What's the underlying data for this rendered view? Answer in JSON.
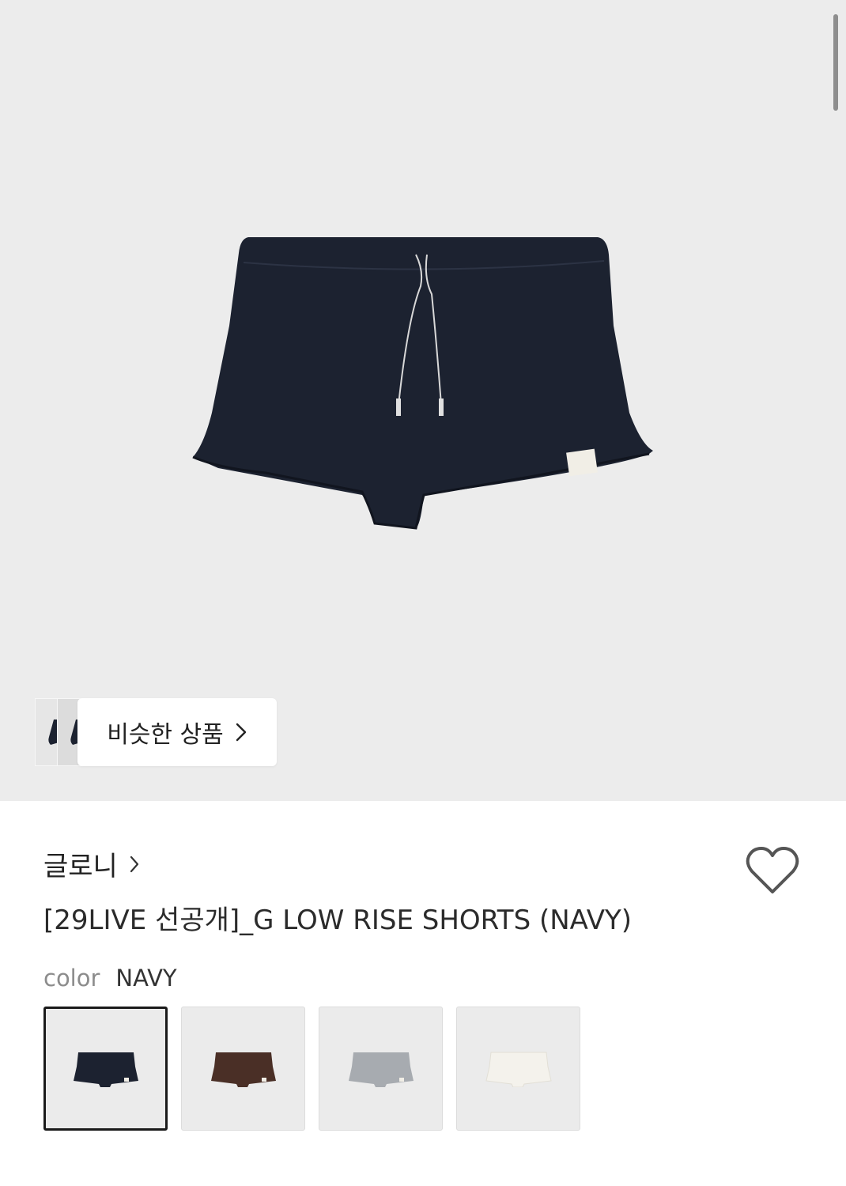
{
  "similar": {
    "label": "비슷한 상품"
  },
  "brand": {
    "name": "글로니"
  },
  "product": {
    "title": "[29LIVE 선공개]_G LOW RISE SHORTS (NAVY)"
  },
  "options": {
    "color_label": "color",
    "color_value": "NAVY",
    "swatches": [
      {
        "name": "NAVY",
        "color": "#1c2230",
        "selected": true
      },
      {
        "name": "BROWN",
        "color": "#4a2f26",
        "selected": false
      },
      {
        "name": "GRAY",
        "color": "#a7abb0",
        "selected": false
      },
      {
        "name": "WHITE",
        "color": "#f4f2ec",
        "selected": false
      }
    ]
  },
  "icons": {
    "chevron": "chevron-right-icon",
    "wishlist": "heart-outline-icon"
  },
  "colors": {
    "hero_background": "#ececec",
    "product_navy": "#1c2230"
  }
}
